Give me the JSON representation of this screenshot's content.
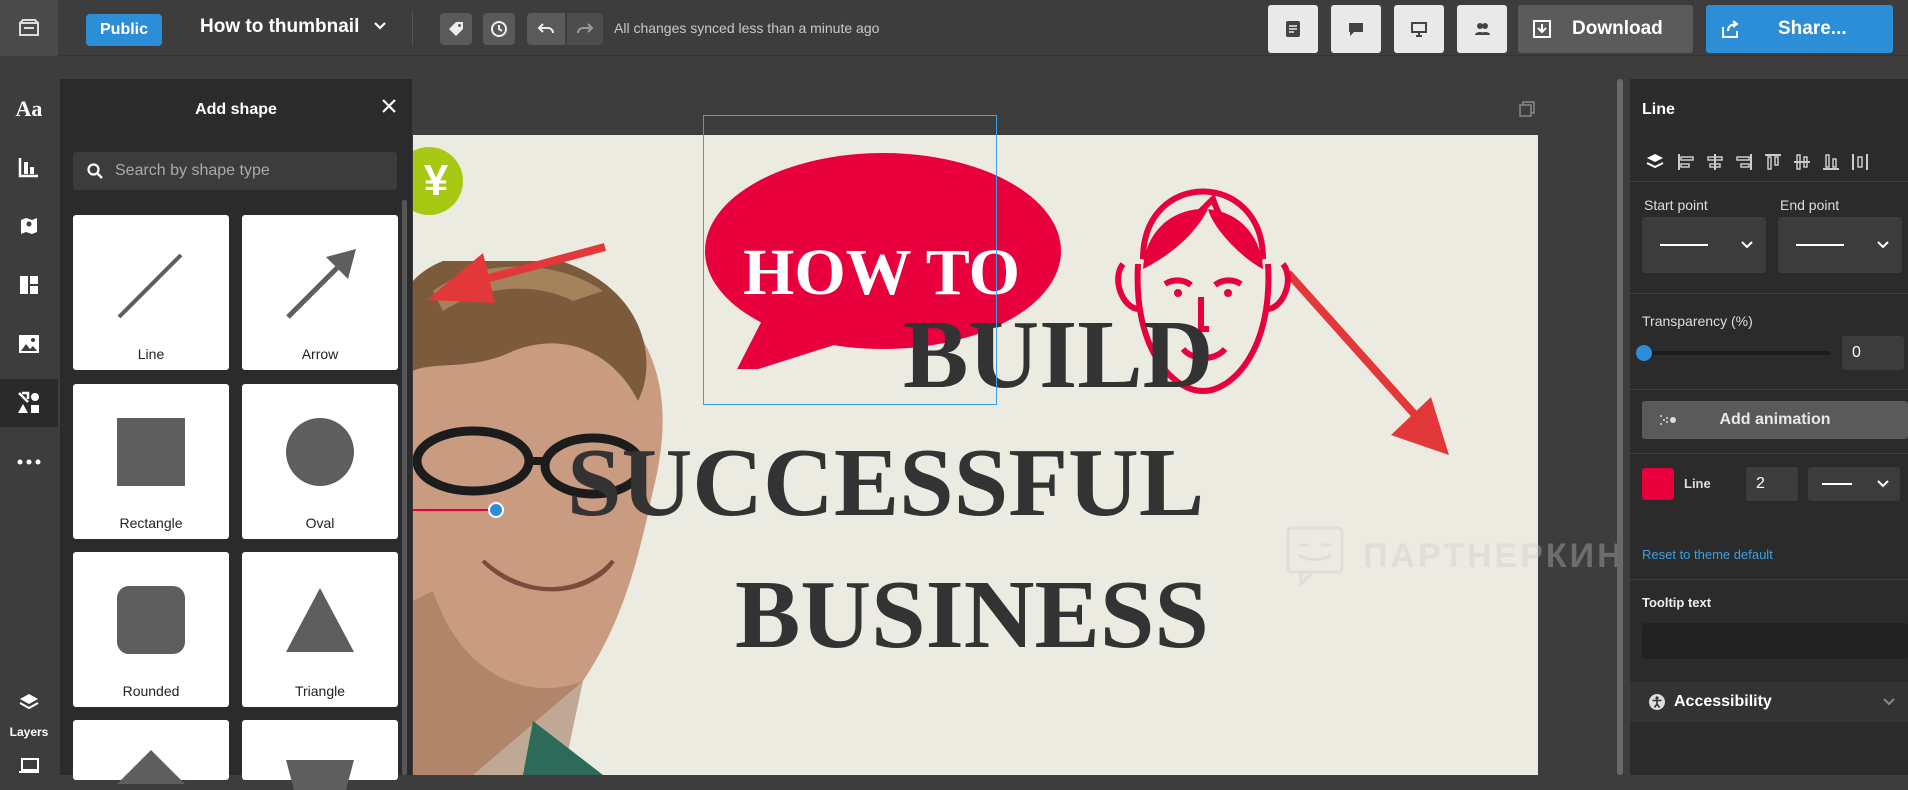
{
  "topbar": {
    "visibility_label": "Public",
    "title": "How to thumbnail",
    "sync_status": "All changes synced less than a minute ago",
    "download_label": "Download",
    "share_label": "Share..."
  },
  "rail": {
    "items": [
      "text-icon",
      "chart-icon",
      "map-icon",
      "layout-icon",
      "image-icon",
      "shapes-icon",
      "more-icon"
    ],
    "layers_label": "Layers"
  },
  "shape_panel": {
    "title": "Add shape",
    "search_placeholder": "Search by shape type",
    "shapes": [
      "Line",
      "Arrow",
      "Rectangle",
      "Oval",
      "Rounded",
      "Triangle"
    ]
  },
  "canvas": {
    "bubble_text": "HOW TO",
    "line1": "BUILD",
    "line2": "SUCCESSFUL",
    "line3": "BUSINESS",
    "yen_symbol": "¥",
    "watermark": "ПАРТНЕРКИН"
  },
  "properties": {
    "title": "Line",
    "start_point_label": "Start point",
    "end_point_label": "End point",
    "transparency_label": "Transparency (%)",
    "transparency_value": "0",
    "transparency_fraction": 0,
    "add_animation_label": "Add animation",
    "line_label": "Line",
    "line_width": "2",
    "line_color": "#e8003c",
    "reset_label": "Reset to theme default",
    "tooltip_label": "Tooltip text",
    "accessibility_label": "Accessibility"
  },
  "colors": {
    "accent": "#2b8ed6",
    "brand_red": "#e8003c",
    "yen_green": "#a8c914"
  }
}
